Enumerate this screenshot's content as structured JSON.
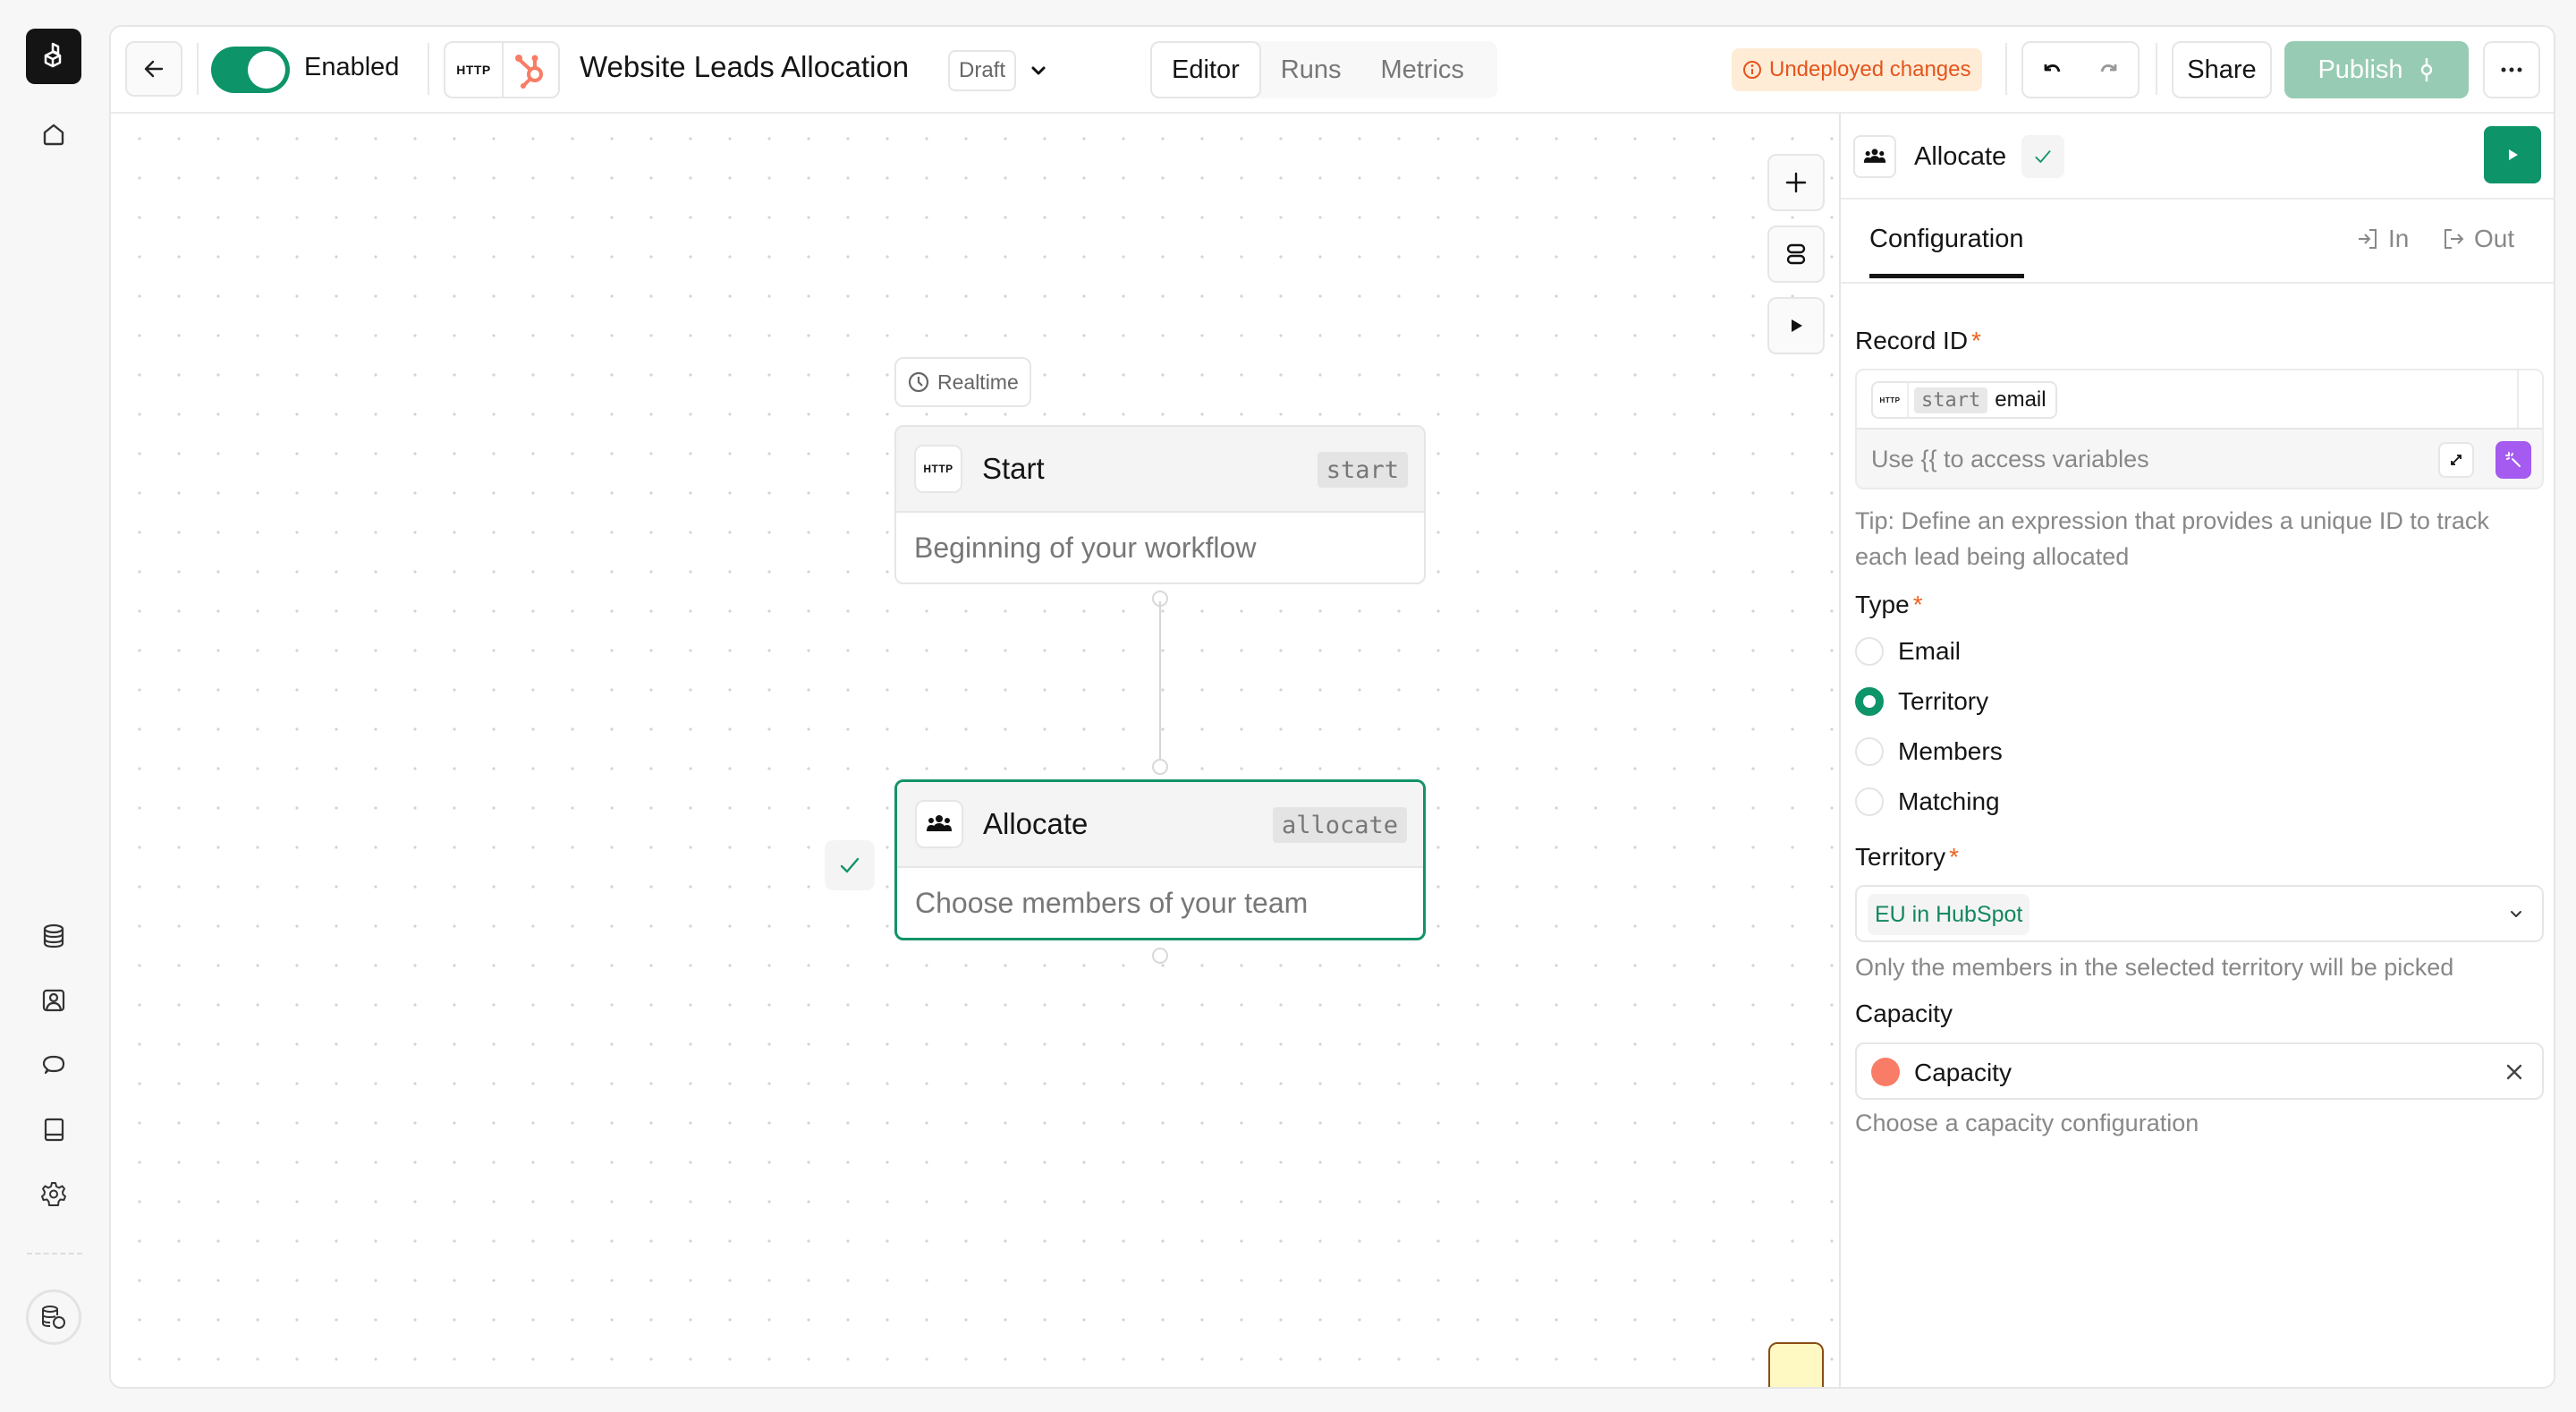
{
  "sidebar": {
    "icons": [
      "logo-icon",
      "home-icon",
      "database-icon",
      "contacts-icon",
      "chat-icon",
      "book-icon",
      "settings-icon",
      "workspace-db-icon"
    ]
  },
  "header": {
    "back_label": "Back",
    "enabled": true,
    "enabled_label": "Enabled",
    "integrations": [
      "HTTP",
      "HubSpot"
    ],
    "http_label": "HTTP",
    "title": "Website Leads Allocation",
    "status_badge": "Draft",
    "tabs": [
      {
        "label": "Editor",
        "active": true
      },
      {
        "label": "Runs",
        "active": false
      },
      {
        "label": "Metrics",
        "active": false
      }
    ],
    "warning": "Undeployed changes",
    "share_label": "Share",
    "publish_label": "Publish",
    "colors": {
      "accent": "#0e9469",
      "publish_disabled": "#98cbb4",
      "warning_bg": "#feecd7",
      "warning_text": "#e5541c",
      "hubspot": "#f87c66"
    }
  },
  "canvas": {
    "trigger_label": "Realtime",
    "nodes": [
      {
        "title": "Start",
        "key": "start",
        "description": "Beginning of your workflow",
        "icon": "http-icon",
        "selected": false
      },
      {
        "title": "Allocate",
        "key": "allocate",
        "description": "Choose members of your team",
        "icon": "team-icon",
        "selected": true,
        "valid": true
      }
    ]
  },
  "panel": {
    "title": "Allocate",
    "tabs": {
      "configuration": "Configuration",
      "in": "In",
      "out": "Out"
    },
    "record_id": {
      "label": "Record ID",
      "required": "*",
      "chip_source": "HTTP",
      "chip_key": "start",
      "chip_property": "email",
      "placeholder": "Use {{ to access variables",
      "help": "Tip: Define an expression that provides a unique ID to track each lead being allocated"
    },
    "type": {
      "label": "Type",
      "required": "*",
      "options": [
        {
          "label": "Email",
          "checked": false
        },
        {
          "label": "Territory",
          "checked": true
        },
        {
          "label": "Members",
          "checked": false
        },
        {
          "label": "Matching",
          "checked": false
        }
      ]
    },
    "territory": {
      "label": "Territory",
      "required": "*",
      "value": "EU in HubSpot",
      "help": "Only the members in the selected territory will be picked"
    },
    "capacity": {
      "label": "Capacity",
      "value": "Capacity",
      "color": "#f87c66",
      "help": "Choose a capacity configuration"
    }
  }
}
